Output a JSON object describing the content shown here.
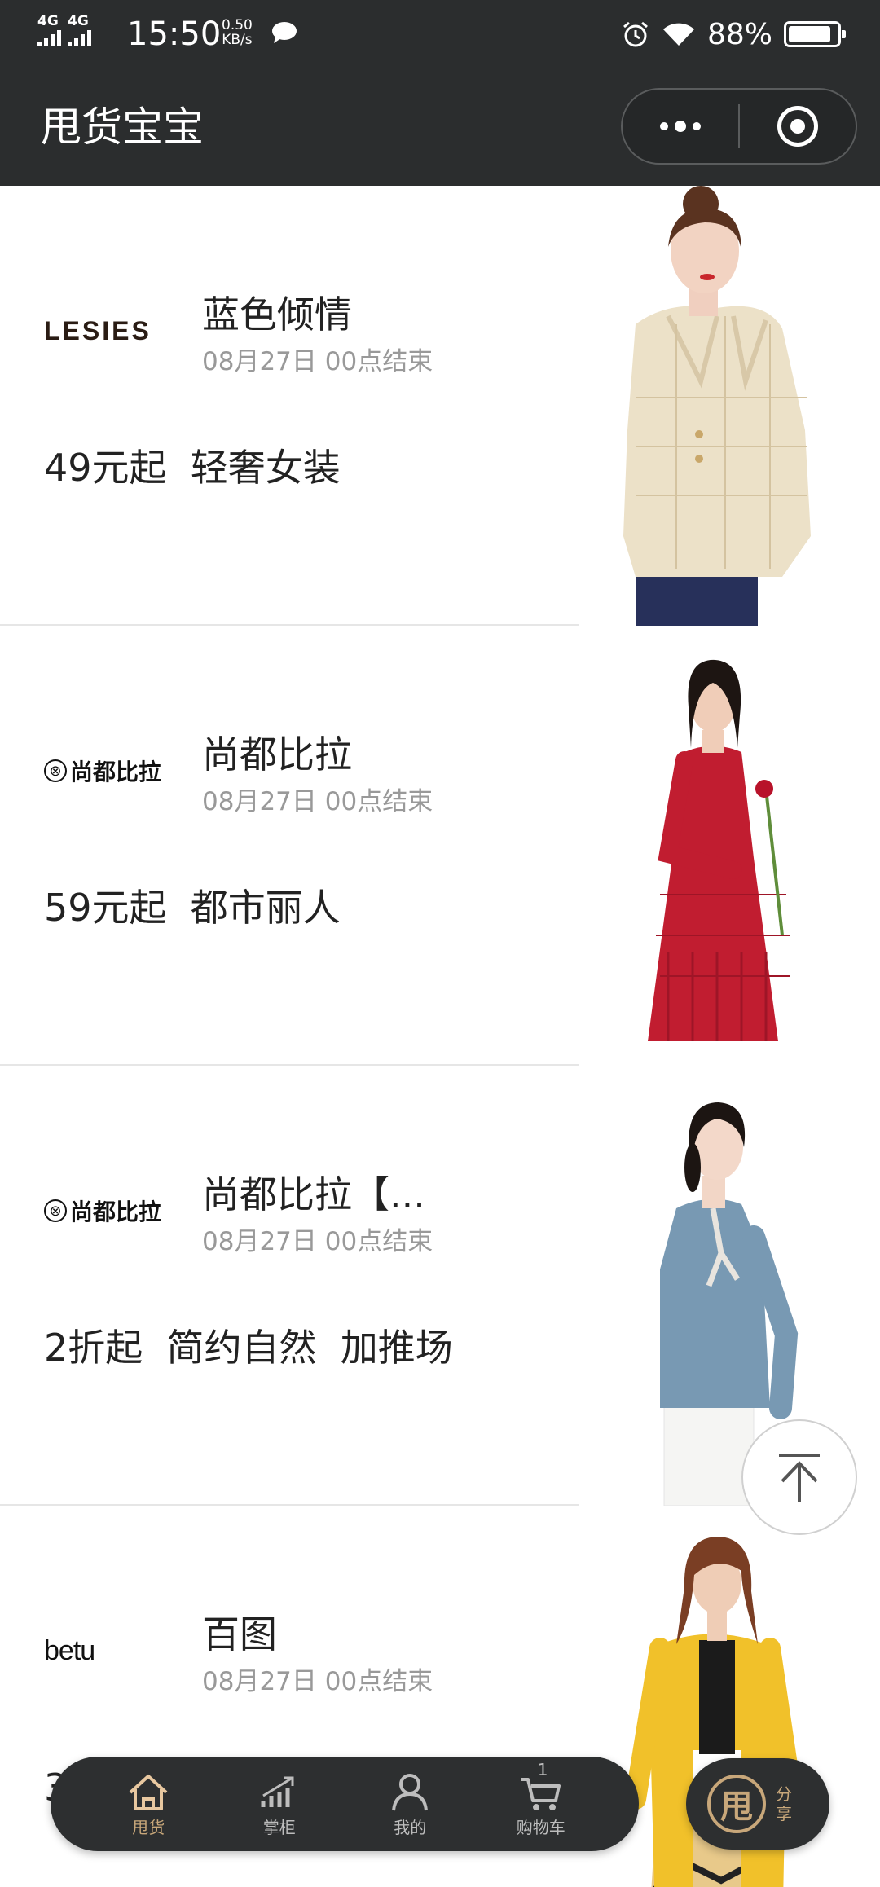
{
  "status_bar": {
    "network1": "4G",
    "network2": "4G",
    "time": "15:50",
    "speed_value": "0.50",
    "speed_unit": "KB/s",
    "battery_percent": "88%",
    "battery_level": 0.88,
    "icons": [
      "signal-icon",
      "chat-icon",
      "alarm-icon",
      "wifi-icon",
      "battery-icon"
    ]
  },
  "nav": {
    "title": "甩货宝宝",
    "more_icon": "more-dots-icon",
    "close_icon": "target-icon"
  },
  "cards": [
    {
      "brand": "LESIES",
      "title": "蓝色倾情",
      "date": "08月27日 00点结束",
      "promo": "49元起  轻奢女装",
      "image": "model-cream-jacket"
    },
    {
      "brand": "尚都比拉",
      "title": "尚都比拉",
      "date": "08月27日 00点结束",
      "promo": "59元起  都市丽人",
      "image": "model-red-dress"
    },
    {
      "brand": "尚都比拉",
      "title": "尚都比拉【...",
      "date": "08月27日 00点结束",
      "promo": "2折起  简约自然  加推场",
      "image": "model-blue-blouse"
    },
    {
      "brand": "betu",
      "title": "百图",
      "date": "08月27日 00点结束",
      "promo": "3",
      "image": "model-yellow-coat"
    }
  ],
  "back_to_top_icon": "arrow-up-icon",
  "tabs": [
    {
      "label": "甩货",
      "icon": "home-icon",
      "active": true
    },
    {
      "label": "掌柜",
      "icon": "growth-chart-icon",
      "active": false
    },
    {
      "label": "我的",
      "icon": "user-icon",
      "active": false
    },
    {
      "label": "购物车",
      "icon": "cart-icon",
      "active": false,
      "badge": "1"
    }
  ],
  "share": {
    "logo_char": "甩",
    "label": "分享"
  },
  "colors": {
    "header_bg": "#2b2d2e",
    "accent_gold": "#c8a77a",
    "divider": "#e6e6e6"
  }
}
